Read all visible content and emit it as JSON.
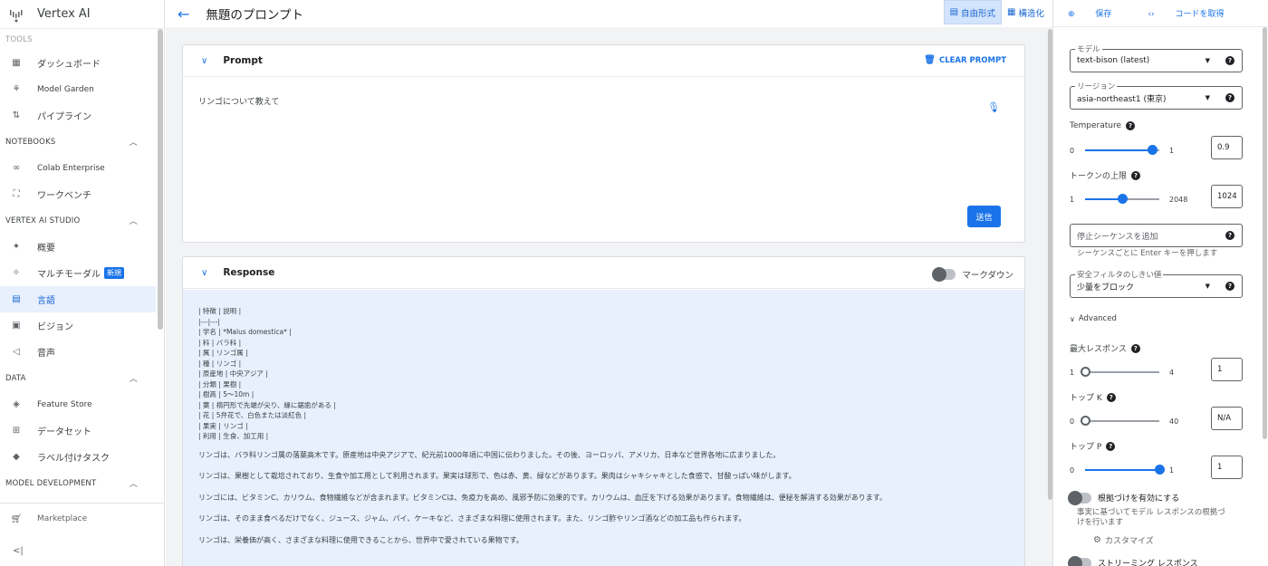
{
  "app": {
    "name": "Vertex AI"
  },
  "sidebar": {
    "sections": [
      {
        "title": "TOOLS",
        "items": [
          {
            "label": "ダッシュボード",
            "icon": "dashboard-icon"
          },
          {
            "label": "Model Garden",
            "icon": "model-garden-icon"
          },
          {
            "label": "パイプライン",
            "icon": "pipeline-icon"
          }
        ]
      },
      {
        "title": "NOTEBOOKS",
        "items": [
          {
            "label": "Colab Enterprise",
            "icon": "colab-icon"
          },
          {
            "label": "ワークベンチ",
            "icon": "workbench-icon"
          }
        ]
      },
      {
        "title": "VERTEX AI STUDIO",
        "items": [
          {
            "label": "概要",
            "icon": "overview-icon"
          },
          {
            "label": "マルチモーダル",
            "icon": "sparkle-icon",
            "badge": "新規"
          },
          {
            "label": "言語",
            "icon": "language-icon",
            "active": true
          },
          {
            "label": "ビジョン",
            "icon": "vision-icon"
          },
          {
            "label": "音声",
            "icon": "speech-icon"
          }
        ]
      },
      {
        "title": "DATA",
        "items": [
          {
            "label": "Feature Store",
            "icon": "feature-store-icon"
          },
          {
            "label": "データセット",
            "icon": "dataset-icon"
          },
          {
            "label": "ラベル付けタスク",
            "icon": "label-icon"
          }
        ]
      },
      {
        "title": "MODEL DEVELOPMENT",
        "items": []
      }
    ],
    "marketplace": "Marketplace",
    "collapse": "<|"
  },
  "topbar": {
    "title": "無題のプロンプト",
    "mode_freeform": "自由形式",
    "mode_structured": "構造化"
  },
  "prompt": {
    "header": "Prompt",
    "clear_label": "CLEAR PROMPT",
    "text": "リンゴについて教えて",
    "send_label": "送信"
  },
  "response": {
    "header": "Response",
    "markdown_label": "マークダウン",
    "table_lines": [
      "| 特徴 | 説明 |",
      "|---|---|",
      "| 学名 | *Malus domestica* |",
      "| 科 | バラ科 |",
      "| 属 | リンゴ属 |",
      "| 種 | リンゴ |",
      "| 原産地 | 中央アジア |",
      "| 分類 | 果樹 |",
      "| 樹高 | 5〜10m |",
      "| 葉 | 楕円形で先端が尖り、縁に鋸歯がある |",
      "| 花 | 5弁花で、白色または淡紅色 |",
      "| 果実 | リンゴ |",
      "| 利用 | 生食、加工用 |"
    ],
    "paragraphs": [
      "リンゴは、バラ科リンゴ属の落葉高木です。原産地は中央アジアで、紀元前1000年頃に中国に伝わりました。その後、ヨーロッパ、アメリカ、日本など世界各地に広まりました。",
      "リンゴは、果樹として栽培されており、生食や加工用として利用されます。果実は球形で、色は赤、黄、緑などがあります。果肉はシャキシャキとした食感で、甘酸っぱい味がします。",
      "リンゴには、ビタミンC、カリウム、食物繊維などが含まれます。ビタミンCは、免疫力を高め、風邪予防に効果的です。カリウムは、血圧を下げる効果があります。食物繊維は、便秘を解消する効果があります。",
      "リンゴは、そのまま食べるだけでなく、ジュース、ジャム、パイ、ケーキなど、さまざまな料理に使用されます。また、リンゴ酢やリンゴ酒などの加工品も作られます。",
      "リンゴは、栄養価が高く、さまざまな料理に使用できることから、世界中で愛されている果物です。"
    ]
  },
  "right_panel": {
    "save_label": "保存",
    "get_code_label": "コードを取得",
    "model": {
      "label": "モデル",
      "value": "text-bison (latest)"
    },
    "region": {
      "label": "リージョン",
      "value": "asia-northeast1 (東京)"
    },
    "temperature": {
      "label": "Temperature",
      "min": "0",
      "max": "1",
      "value": "0.9",
      "fraction": 0.9
    },
    "max_tokens": {
      "label": "トークンの上限",
      "min": "1",
      "max": "2048",
      "value": "1024",
      "fraction": 0.5
    },
    "stop_sequence": {
      "placeholder": "停止シーケンスを追加",
      "hint": "シーケンスごとに Enter キーを押します"
    },
    "safety": {
      "label": "安全フィルタのしきい値",
      "value": "少量をブロック"
    },
    "advanced_label": "Advanced",
    "max_responses": {
      "label": "最大レスポンス",
      "min": "1",
      "max": "4",
      "value": "1",
      "fraction": 0
    },
    "top_k": {
      "label": "トップ K",
      "min": "0",
      "max": "40",
      "value": "N/A",
      "fraction": 0
    },
    "top_p": {
      "label": "トップ P",
      "min": "0",
      "max": "1",
      "value": "1",
      "fraction": 1
    },
    "grounding": {
      "label": "根拠づけを有効にする",
      "hint_line1": "事実に基づいてモデル レスポンスの根拠づ",
      "hint_line2": "けを行います",
      "customize": "カスタマイズ"
    },
    "streaming": {
      "label": "ストリーミング レスポンス"
    }
  }
}
